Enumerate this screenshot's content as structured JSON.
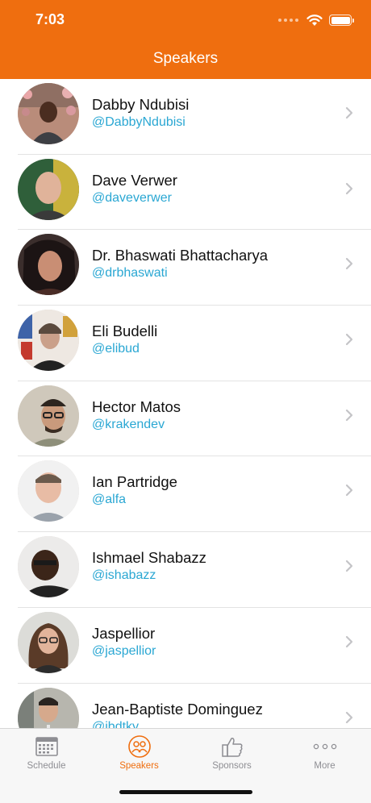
{
  "status_bar": {
    "time": "7:03"
  },
  "nav": {
    "title": "Speakers"
  },
  "speakers": [
    {
      "name": "Dabby Ndubisi",
      "handle": "@DabbyNdubisi"
    },
    {
      "name": "Dave Verwer",
      "handle": "@daveverwer"
    },
    {
      "name": "Dr. Bhaswati Bhattacharya",
      "handle": "@drbhaswati"
    },
    {
      "name": "Eli Budelli",
      "handle": "@elibud"
    },
    {
      "name": "Hector Matos",
      "handle": "@krakendev"
    },
    {
      "name": "Ian Partridge",
      "handle": "@alfa"
    },
    {
      "name": "Ishmael Shabazz",
      "handle": "@ishabazz"
    },
    {
      "name": "Jaspellior",
      "handle": "@jaspellior"
    },
    {
      "name": "Jean-Baptiste Dominguez",
      "handle": "@jbdtky"
    }
  ],
  "tabs": [
    {
      "label": "Schedule",
      "icon": "calendar-icon"
    },
    {
      "label": "Speakers",
      "icon": "speakers-icon"
    },
    {
      "label": "Sponsors",
      "icon": "thumbs-up-icon"
    },
    {
      "label": "More",
      "icon": "more-icon"
    }
  ],
  "colors": {
    "accent": "#ef6e0f",
    "handle": "#2aa7d3",
    "tab_inactive": "#8e8e93"
  }
}
